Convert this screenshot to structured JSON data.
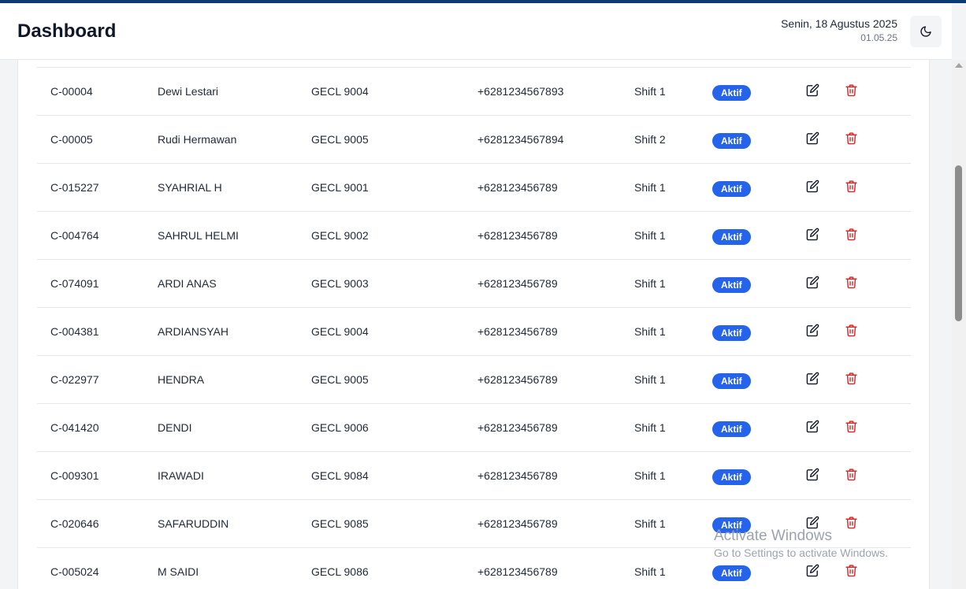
{
  "header": {
    "title": "Dashboard",
    "date": "Senin, 18 Agustus 2025",
    "time": "01.05.25",
    "theme_toggle_icon": "moon-icon"
  },
  "table": {
    "rows": [
      {
        "id": "C-00004",
        "name": "Dewi Lestari",
        "unit": "GECL 9004",
        "phone": "+6281234567893",
        "shift": "Shift 1",
        "status": "Aktif"
      },
      {
        "id": "C-00005",
        "name": "Rudi Hermawan",
        "unit": "GECL 9005",
        "phone": "+6281234567894",
        "shift": "Shift 2",
        "status": "Aktif"
      },
      {
        "id": "C-015227",
        "name": "SYAHRIAL H",
        "unit": "GECL 9001",
        "phone": "+628123456789",
        "shift": "Shift 1",
        "status": "Aktif"
      },
      {
        "id": "C-004764",
        "name": "SAHRUL HELMI",
        "unit": "GECL 9002",
        "phone": "+628123456789",
        "shift": "Shift 1",
        "status": "Aktif"
      },
      {
        "id": "C-074091",
        "name": "ARDI ANAS",
        "unit": "GECL 9003",
        "phone": "+628123456789",
        "shift": "Shift 1",
        "status": "Aktif"
      },
      {
        "id": "C-004381",
        "name": "ARDIANSYAH",
        "unit": "GECL 9004",
        "phone": "+628123456789",
        "shift": "Shift 1",
        "status": "Aktif"
      },
      {
        "id": "C-022977",
        "name": "HENDRA",
        "unit": "GECL 9005",
        "phone": "+628123456789",
        "shift": "Shift 1",
        "status": "Aktif"
      },
      {
        "id": "C-041420",
        "name": "DENDI",
        "unit": "GECL 9006",
        "phone": "+628123456789",
        "shift": "Shift 1",
        "status": "Aktif"
      },
      {
        "id": "C-009301",
        "name": "IRAWADI",
        "unit": "GECL 9084",
        "phone": "+628123456789",
        "shift": "Shift 1",
        "status": "Aktif"
      },
      {
        "id": "C-020646",
        "name": "SAFARUDDIN",
        "unit": "GECL 9085",
        "phone": "+628123456789",
        "shift": "Shift 1",
        "status": "Aktif"
      },
      {
        "id": "C-005024",
        "name": "M SAIDI",
        "unit": "GECL 9086",
        "phone": "+628123456789",
        "shift": "Shift 1",
        "status": "Aktif"
      }
    ],
    "edit_icon": "edit-icon",
    "delete_icon": "trash-icon"
  },
  "watermark": {
    "title": "Activate Windows",
    "subtitle": "Go to Settings to activate Windows."
  },
  "colors": {
    "accent": "#2563eb",
    "danger": "#dc2626",
    "top_border": "#0b3a75"
  }
}
